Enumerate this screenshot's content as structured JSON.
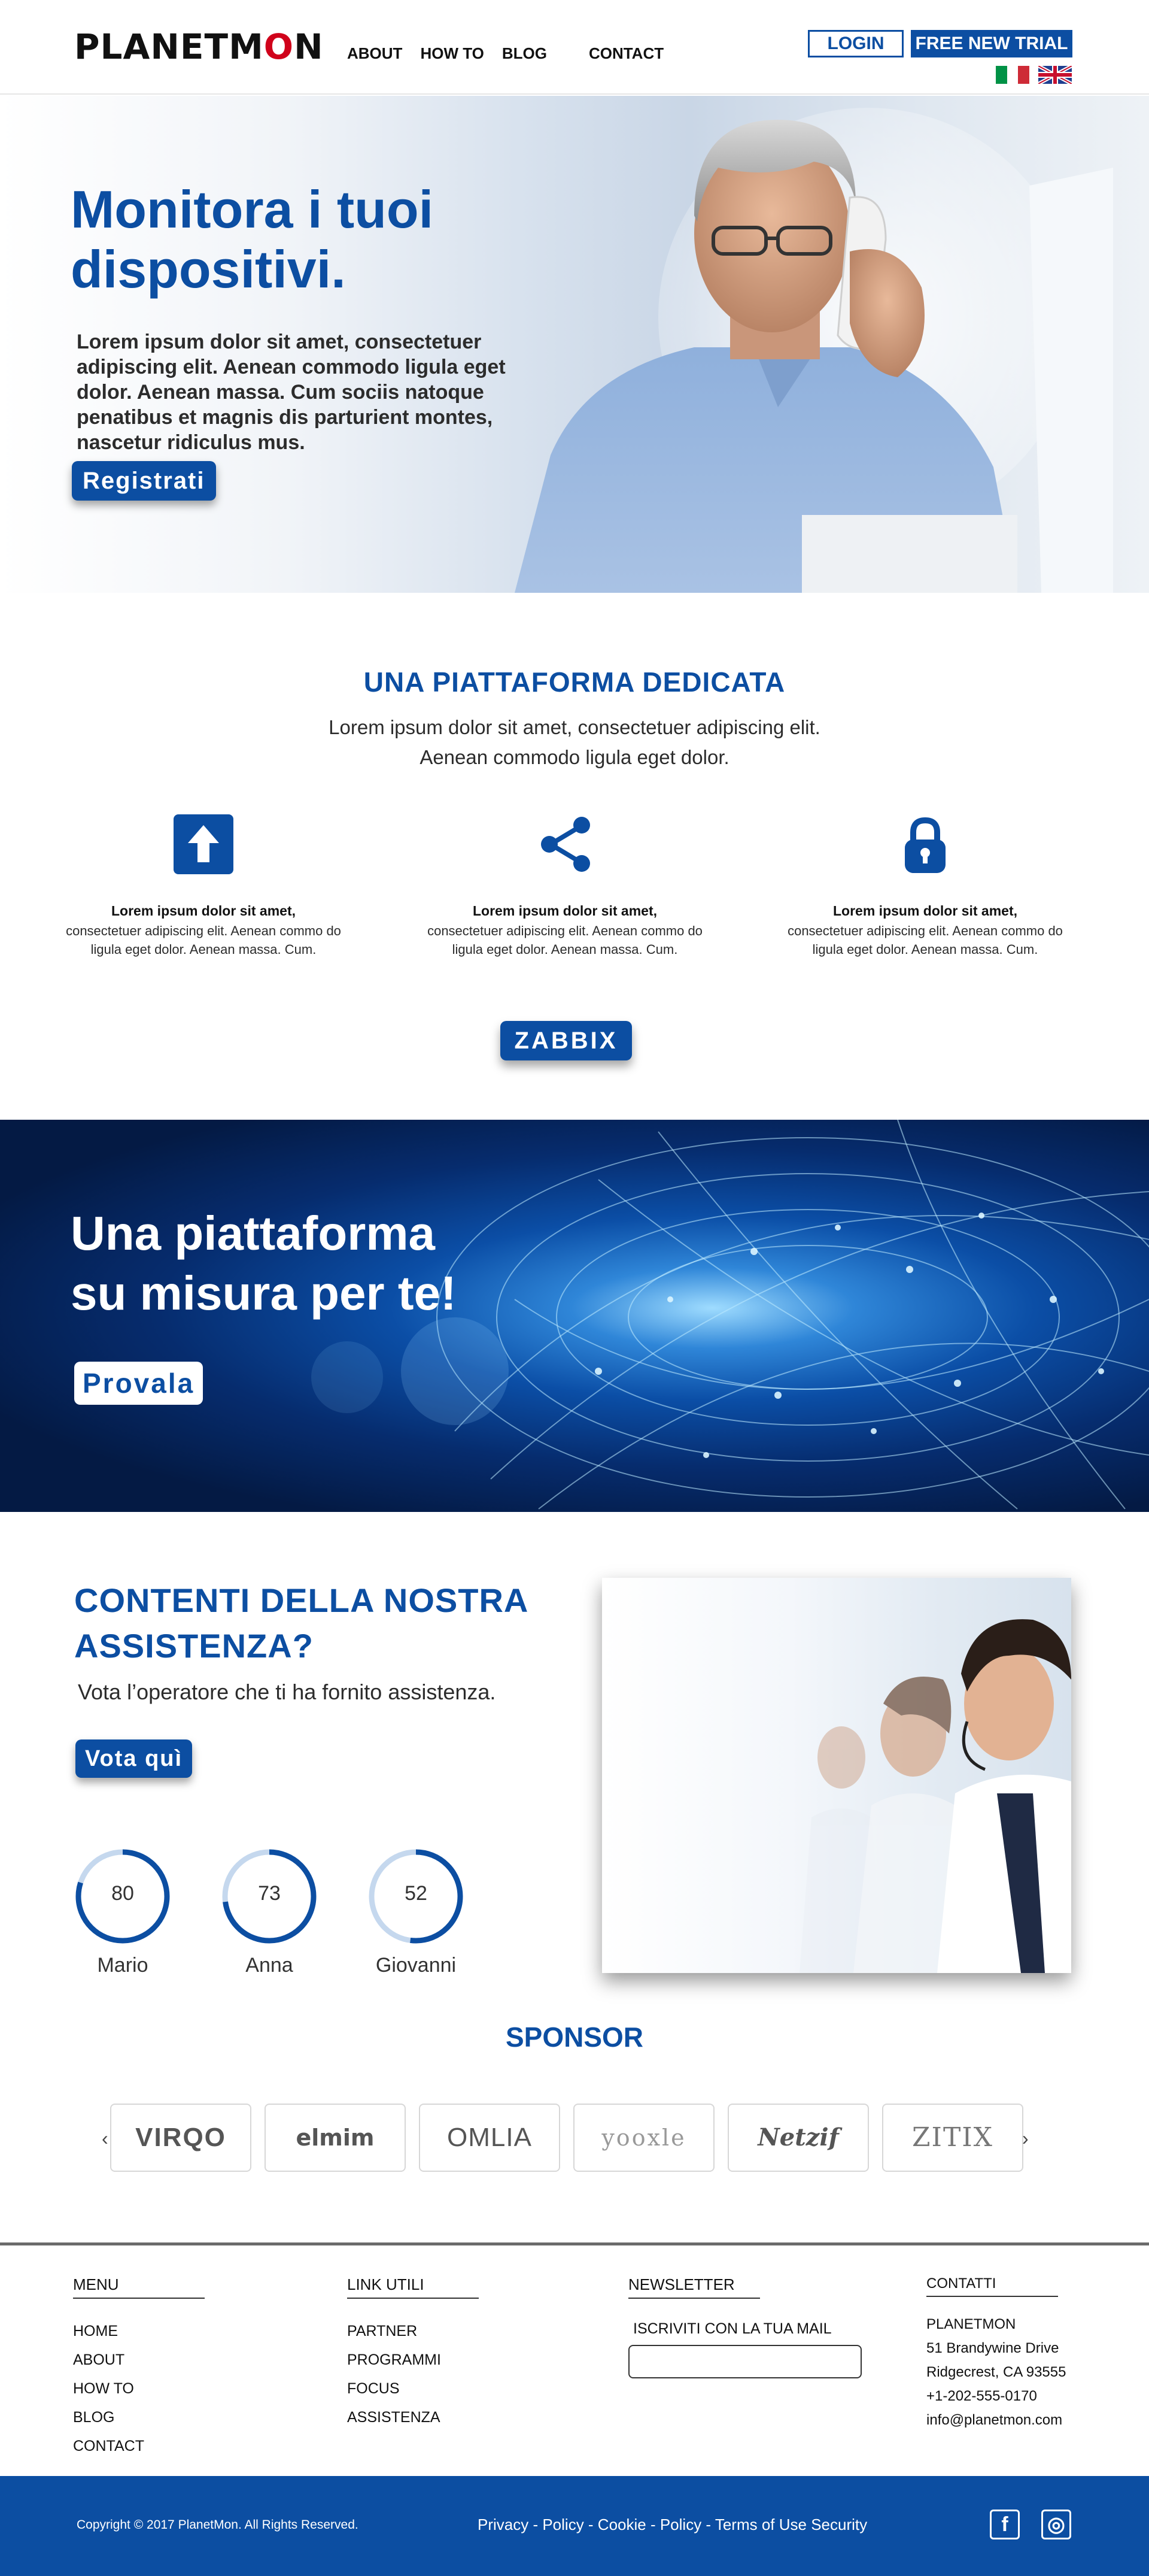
{
  "header": {
    "logo_prefix": "PLANETM",
    "logo_o": "O",
    "logo_suffix": "N",
    "nav": [
      "ABOUT",
      "HOW TO",
      "BLOG",
      "CONTACT"
    ],
    "login_label": "LOGIN",
    "trial_label": "FREE NEW TRIAL",
    "languages": [
      "Italiano",
      "English"
    ]
  },
  "hero": {
    "title": "Monitora i tuoi dispositivi.",
    "text": "Lorem ipsum dolor sit amet, consectetuer adipiscing elit. Aenean commodo ligula eget dolor. Aenean massa. Cum sociis natoque penatibus et magnis dis parturient montes, nascetur ridiculus mus.",
    "cta": "Registrati"
  },
  "platform": {
    "title": "UNA PIATTAFORMA DEDICATA",
    "subtitle": "Lorem ipsum dolor sit amet, consectetuer adipiscing elit. Aenean commodo ligula eget dolor.",
    "features": [
      {
        "icon": "upload-icon",
        "title": "Lorem ipsum dolor sit amet,",
        "text": "consectetuer adipiscing elit. Aenean commo do ligula eget dolor. Aenean massa. Cum."
      },
      {
        "icon": "share-icon",
        "title": "Lorem ipsum dolor sit amet,",
        "text": "consectetuer adipiscing elit. Aenean commo do ligula eget dolor. Aenean massa. Cum."
      },
      {
        "icon": "lock-icon",
        "title": "Lorem ipsum dolor sit amet,",
        "text": "consectetuer adipiscing elit. Aenean commo do ligula eget dolor. Aenean massa. Cum."
      }
    ],
    "cta": "ZABBIX"
  },
  "banner": {
    "title_line1": "Una piattaforma",
    "title_line2": "su misura per te!",
    "cta": "Provala"
  },
  "assistance": {
    "title": "CONTENTI DELLA NOSTRA ASSISTENZA?",
    "subtitle": "Vota l’operatore che ti ha fornito assistenza.",
    "cta": "Vota quì",
    "operators": [
      {
        "name": "Mario",
        "score": 80
      },
      {
        "name": "Anna",
        "score": 73
      },
      {
        "name": "Giovanni",
        "score": 52
      }
    ]
  },
  "sponsor": {
    "title": "SPONSOR",
    "prev": "‹",
    "next": "›",
    "logos": [
      "VIRQO",
      "elmim",
      "OMLIA",
      "yooxle",
      "Netzif",
      "ZITIX"
    ]
  },
  "footer": {
    "menu_title": "MENU",
    "menu": [
      "HOME",
      "ABOUT",
      "HOW TO",
      "BLOG",
      "CONTACT"
    ],
    "links_title": "LINK UTILI",
    "links": [
      "PARTNER",
      "PROGRAMMI",
      "FOCUS",
      "ASSISTENZA"
    ],
    "newsletter_title": "NEWSLETTER",
    "newsletter_label": "ISCRIVITI CON LA TUA MAIL",
    "contacts_title": "CONTATTI",
    "contacts": [
      "PLANETMON",
      "51 Brandywine Drive",
      "Ridgecrest, CA 93555",
      "+1-202-555-0170",
      "info@planetmon.com"
    ]
  },
  "bottom": {
    "copyright": "Copyright © 2017 PlanetMon. All Rights Reserved.",
    "legal": "Privacy - Policy - Cookie - Policy - Terms of Use Security",
    "social": [
      "f",
      "◎"
    ]
  },
  "colors": {
    "brand": "#0c4ea2",
    "logo_accent": "#d0021b",
    "footer_bar": "#0c4ea2"
  }
}
